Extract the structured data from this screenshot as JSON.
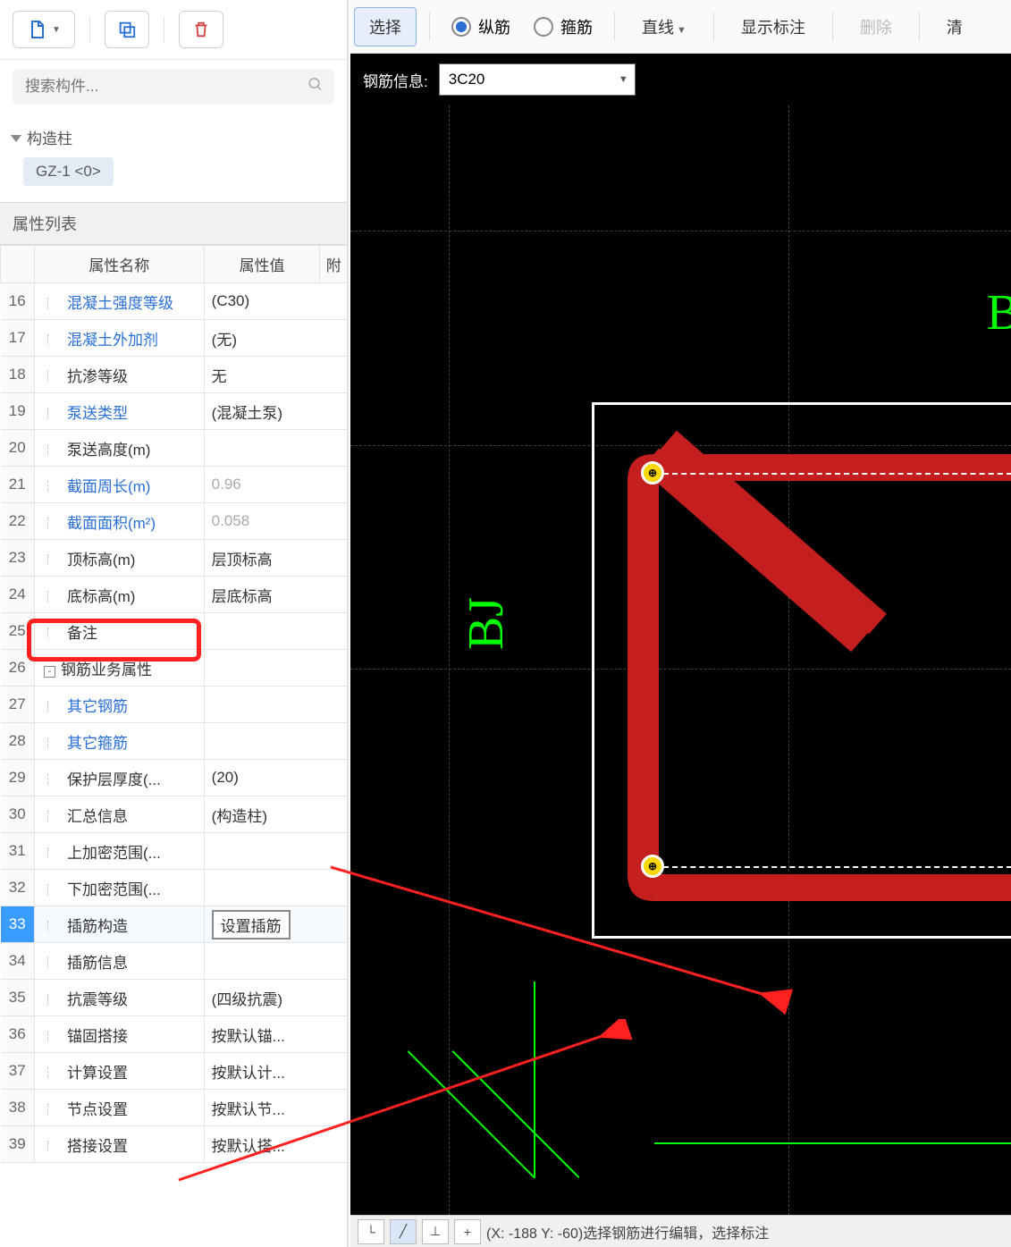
{
  "search": {
    "placeholder": "搜索构件..."
  },
  "tree": {
    "root": "构造柱",
    "child": "GZ-1  <0>"
  },
  "props_header": "属性列表",
  "table_headers": {
    "name": "属性名称",
    "value": "属性值",
    "att": "附"
  },
  "rows": [
    {
      "n": "16",
      "name": "混凝土强度等级",
      "link": true,
      "val": "(C30)"
    },
    {
      "n": "17",
      "name": "混凝土外加剂",
      "link": true,
      "val": "(无)"
    },
    {
      "n": "18",
      "name": "抗渗等级",
      "val": "无"
    },
    {
      "n": "19",
      "name": "泵送类型",
      "link": true,
      "val": "(混凝土泵)"
    },
    {
      "n": "20",
      "name": "泵送高度(m)",
      "val": ""
    },
    {
      "n": "21",
      "name": "截面周长(m)",
      "link": true,
      "val": "0.96",
      "gray": true
    },
    {
      "n": "22",
      "name": "截面面积(m²)",
      "link": true,
      "val": "0.058",
      "gray": true
    },
    {
      "n": "23",
      "name": "顶标高(m)",
      "val": "层顶标高"
    },
    {
      "n": "24",
      "name": "底标高(m)",
      "val": "层底标高"
    },
    {
      "n": "25",
      "name": "备注",
      "val": ""
    },
    {
      "n": "26",
      "name": "钢筋业务属性",
      "val": "",
      "group": true
    },
    {
      "n": "27",
      "name": "其它钢筋",
      "link": true,
      "val": ""
    },
    {
      "n": "28",
      "name": "其它箍筋",
      "link": true,
      "val": ""
    },
    {
      "n": "29",
      "name": "保护层厚度(...",
      "val": "(20)"
    },
    {
      "n": "30",
      "name": "汇总信息",
      "val": "(构造柱)"
    },
    {
      "n": "31",
      "name": "上加密范围(...",
      "val": ""
    },
    {
      "n": "32",
      "name": "下加密范围(...",
      "val": ""
    },
    {
      "n": "33",
      "name": "插筋构造",
      "val": "设置插筋",
      "sel": true
    },
    {
      "n": "34",
      "name": "插筋信息",
      "val": ""
    },
    {
      "n": "35",
      "name": "抗震等级",
      "val": "(四级抗震)"
    },
    {
      "n": "36",
      "name": "锚固搭接",
      "val": "按默认锚..."
    },
    {
      "n": "37",
      "name": "计算设置",
      "val": "按默认计..."
    },
    {
      "n": "38",
      "name": "节点设置",
      "val": "按默认节..."
    },
    {
      "n": "39",
      "name": "搭接设置",
      "val": "按默认搭..."
    }
  ],
  "right_toolbar": {
    "select": "选择",
    "radio1": "纵筋",
    "radio2": "箍筋",
    "line": "直线",
    "show_label": "显示标注",
    "delete": "删除",
    "clear": "清"
  },
  "rebar_info": {
    "label": "钢筋信息:",
    "value": "3C20"
  },
  "canvas_labels": {
    "left": "BJ",
    "top": "B"
  },
  "status": {
    "coords": "(X: -188 Y: -60)选择钢筋进行编辑，选择标注"
  }
}
